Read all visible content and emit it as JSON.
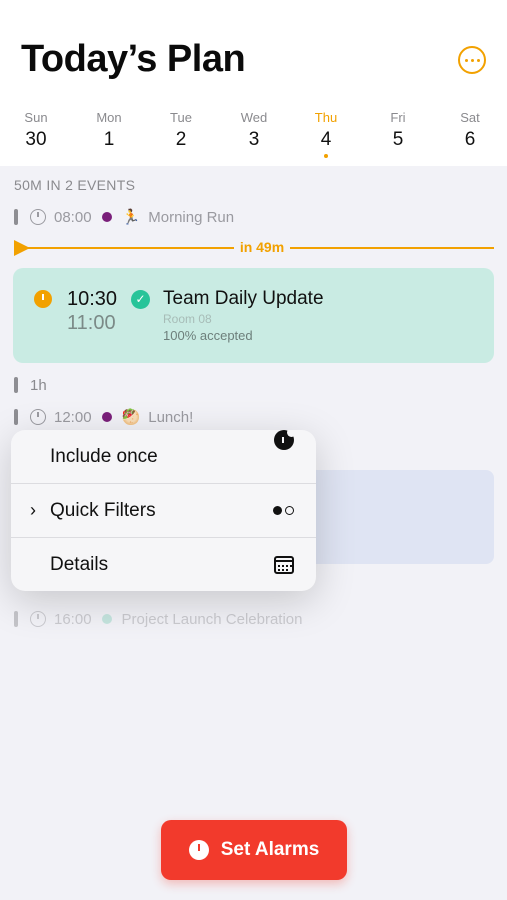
{
  "header": {
    "title": "Today’s Plan",
    "more_icon": "ellipsis-circle-icon"
  },
  "week": [
    {
      "name": "Sun",
      "date": "30"
    },
    {
      "name": "Mon",
      "date": "1"
    },
    {
      "name": "Tue",
      "date": "2"
    },
    {
      "name": "Wed",
      "date": "3"
    },
    {
      "name": "Thu",
      "date": "4",
      "today": true
    },
    {
      "name": "Fri",
      "date": "5"
    },
    {
      "name": "Sat",
      "date": "6"
    }
  ],
  "summary": "50M IN 2 EVENTS",
  "events": {
    "morning_run": {
      "time": "08:00",
      "emoji": "🏃",
      "title": "Morning Run",
      "dot_color": "#7a1f7a"
    },
    "now_label": "in 49m",
    "team_update": {
      "start": "10:30",
      "end": "11:00",
      "title": "Team Daily Update",
      "room": "Room 08",
      "accepted": "100% accepted"
    },
    "gap": "1h",
    "lunch": {
      "time": "12:00",
      "emoji": "🥙",
      "title": "Lunch!",
      "dot_color": "#7a1f7a"
    },
    "launch": {
      "time": "16:00",
      "title": "Project Launch Celebration",
      "dot_color": "#8fd6c4"
    }
  },
  "context_menu": {
    "include_once": "Include once",
    "quick_filters": "Quick Filters",
    "details": "Details"
  },
  "action": {
    "set_alarms": "Set Alarms"
  },
  "colors": {
    "accent": "#f2a100",
    "alarm_button": "#f23a2c",
    "card_green": "#c9ebe3"
  }
}
